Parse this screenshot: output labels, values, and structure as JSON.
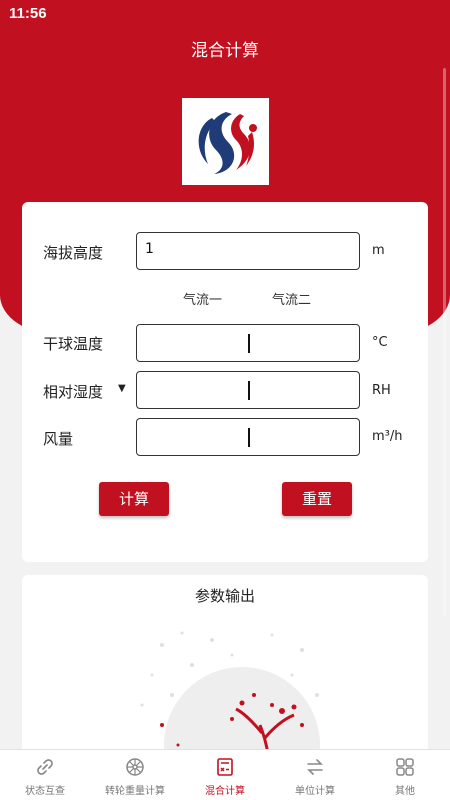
{
  "status": {
    "time": "11:56"
  },
  "header": {
    "title": "混合计算"
  },
  "form": {
    "altitude": {
      "label": "海拔高度",
      "value": "1",
      "unit": "m"
    },
    "columns": {
      "airflow1": "气流一",
      "airflow2": "气流二"
    },
    "dry_bulb": {
      "label": "干球温度",
      "unit": "°C"
    },
    "humidity": {
      "label": "相对湿度",
      "unit": "RH",
      "dropdown_icon": "triangle-down-icon"
    },
    "airflow": {
      "label": "风量",
      "unit": "m³/h"
    },
    "calc_button": "计算",
    "reset_button": "重置"
  },
  "output": {
    "title": "参数输出"
  },
  "tabs": [
    {
      "label": "状态互查",
      "icon": "link-icon",
      "active": false
    },
    {
      "label": "转轮重量计算",
      "icon": "wheel-icon",
      "active": false
    },
    {
      "label": "混合计算",
      "icon": "calculator-icon",
      "active": true
    },
    {
      "label": "单位计算",
      "icon": "swap-icon",
      "active": false
    },
    {
      "label": "其他",
      "icon": "grid-icon",
      "active": false
    }
  ],
  "colors": {
    "brand": "#c1101f",
    "logo_blue": "#1f3b78"
  }
}
